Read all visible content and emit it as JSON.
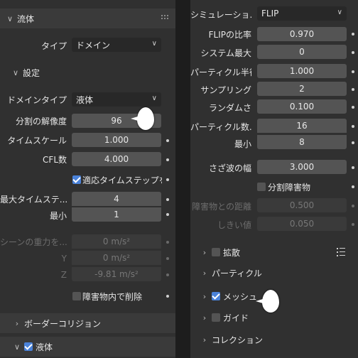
{
  "left": {
    "fluid_header": "流体",
    "type_label": "タイプ",
    "type_value": "ドメイン",
    "settings_header": "設定",
    "domain_type_label": "ドメインタイプ",
    "domain_type_value": "液体",
    "resolution_label": "分割の解像度",
    "resolution_value": "96",
    "time_scale_label": "タイムスケール",
    "time_scale_value": "1.000",
    "cfl_label": "CFL数",
    "cfl_value": "4.000",
    "adaptive_label": "適応タイムステップを...",
    "max_timesteps_label": "最大タイムステ...",
    "max_timesteps_value": "4",
    "min_label": "最小",
    "min_value": "1",
    "gravity_label": "シーンの重力を...",
    "gravity_x": "0 m/s²",
    "y_label": "Y",
    "gravity_y": "0 m/s²",
    "z_label": "Z",
    "gravity_z": "-9.81 m/s²",
    "delete_in_obstacle_label": "障害物内で削除",
    "border_collision_header": "ボーダーコリジョン",
    "liquid_header": "液体"
  },
  "right": {
    "sim_method_label": "シミュレーショ...",
    "sim_method_value": "FLIP",
    "flip_ratio_label": "FLIPの比率",
    "flip_ratio_value": "0.970",
    "system_max_label": "システム最大",
    "system_max_value": "0",
    "particle_radius_label": "パーティクル半径",
    "particle_radius_value": "1.000",
    "sampling_label": "サンプリング",
    "sampling_value": "2",
    "randomness_label": "ランダムさ",
    "randomness_value": "0.100",
    "particle_count_label": "パーティクル数...",
    "particle_count_value": "16",
    "min_label": "最小",
    "min_value": "8",
    "narrow_band_label": "さざ波の幅",
    "narrow_band_value": "3.000",
    "fractional_obstacles_label": "分割障害物",
    "obstacle_distance_label": "障害物との距離",
    "obstacle_distance_value": "0.500",
    "threshold_label": "しきい値",
    "threshold_value": "0.050",
    "diffusion_header": "拡散",
    "particles_header": "パーティクル",
    "mesh_header": "メッシュ",
    "guides_header": "ガイド",
    "collections_header": "コレクション"
  },
  "colors": {
    "accent": "#4a82d9",
    "panel": "#303030",
    "field": "#545454",
    "header": "#3a3a3a"
  },
  "icons": [
    "chevron-down-icon",
    "chevron-right-icon",
    "drag-grip-icon",
    "list-icon",
    "dropdown-arrow-icon",
    "keyframe-dot-icon"
  ]
}
